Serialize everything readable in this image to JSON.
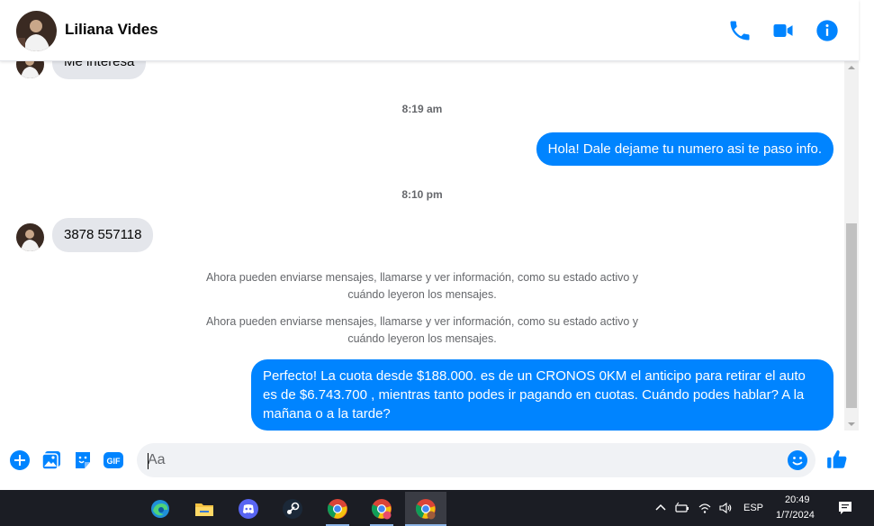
{
  "header": {
    "contact_name": "Liliana Vides"
  },
  "messages": {
    "partial_incoming": "Me interesa",
    "time1": "8:19 am",
    "out1": "Hola! Dale dejame tu numero  asi te paso info.",
    "time2": "8:10 pm",
    "in1": "3878 557118",
    "notice1": "Ahora pueden enviarse mensajes, llamarse y ver información, como su estado activo y cuándo leyeron los mensajes.",
    "notice2": "Ahora pueden enviarse mensajes, llamarse y ver información, como su estado activo y cuándo leyeron los mensajes.",
    "out2": "Perfecto! La cuota desde $188.000. es de un CRONOS 0KM el anticipo para retirar el auto es de $6.743.700 , mientras tanto podes ir pagando en cuotas. Cuándo podes hablar? A la mañana o a la tarde?"
  },
  "composer": {
    "placeholder": "Aa"
  },
  "taskbar": {
    "language": "ESP",
    "time": "20:49",
    "date": "1/7/2024"
  },
  "colors": {
    "messenger_blue": "#0084ff",
    "bubble_gray": "#e4e6eb",
    "taskbar_bg": "#1b1d24"
  }
}
